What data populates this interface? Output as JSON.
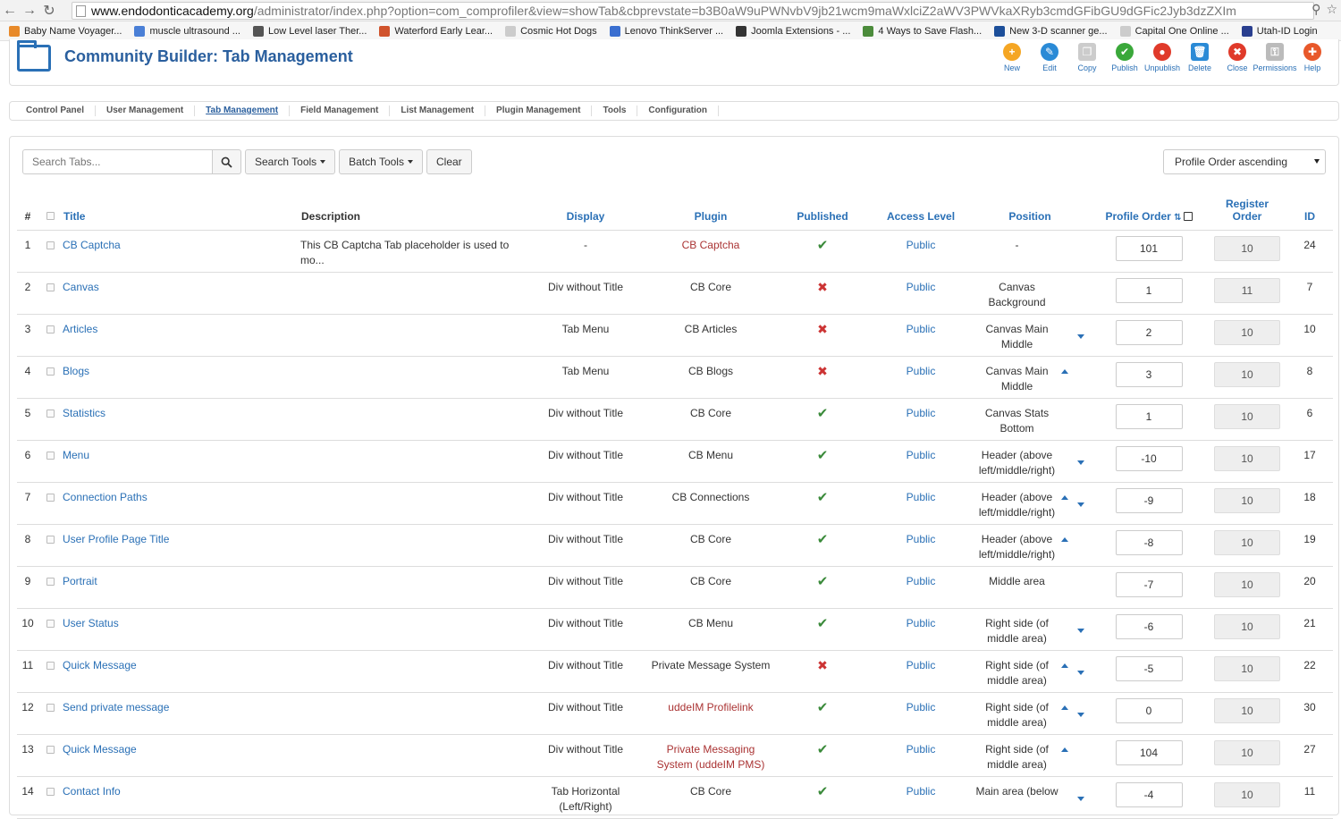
{
  "browser": {
    "url_domain": "www.endodonticacademy.org",
    "url_path": "/administrator/index.php?option=com_comprofiler&view=showTab&cbprevstate=b3B0aW9uPWNvbV9jb21wcm9maWxlciZ2aWV3PWVkaXRyb3cmdGFibGU9dGFic2Jyb3dzZXIm"
  },
  "bookmarks": [
    {
      "label": "Baby Name Voyager...",
      "color": "#e88a2a"
    },
    {
      "label": "muscle ultrasound ...",
      "color": "#4a7fd6"
    },
    {
      "label": "Low Level laser Ther...",
      "color": "#555555"
    },
    {
      "label": "Waterford Early Lear...",
      "color": "#d0532c"
    },
    {
      "label": "Cosmic Hot Dogs",
      "color": "#cccccc"
    },
    {
      "label": "Lenovo ThinkServer ...",
      "color": "#3a6fd0"
    },
    {
      "label": "Joomla Extensions - ...",
      "color": "#333333"
    },
    {
      "label": "4 Ways to Save Flash...",
      "color": "#4b8b3b"
    },
    {
      "label": "New 3-D scanner ge...",
      "color": "#1d4f9a"
    },
    {
      "label": "Capital One Online ...",
      "color": "#cccccc"
    },
    {
      "label": "Utah-ID Login",
      "color": "#2a3f8f"
    }
  ],
  "header": {
    "title": "Community Builder: Tab Management"
  },
  "toolbar": [
    {
      "label": "New",
      "icon": "plus-icon",
      "color": "#f5a623",
      "glyph": "+"
    },
    {
      "label": "Edit",
      "icon": "pencil-icon",
      "color": "#2a8ad6",
      "glyph": "✎"
    },
    {
      "label": "Copy",
      "icon": "copy-icon",
      "color": "#cccccc",
      "glyph": "❐"
    },
    {
      "label": "Publish",
      "icon": "check-icon",
      "color": "#3aa83a",
      "glyph": "✔"
    },
    {
      "label": "Unpublish",
      "icon": "unpublish-icon",
      "color": "#e03a2a",
      "glyph": "●"
    },
    {
      "label": "Delete",
      "icon": "trash-icon",
      "color": "#2a8ad6",
      "glyph": "🗑"
    },
    {
      "label": "Close",
      "icon": "close-icon",
      "color": "#e03a2a",
      "glyph": "✖"
    },
    {
      "label": "Permissions",
      "icon": "permissions-icon",
      "color": "#bbbbbb",
      "glyph": "⚿"
    },
    {
      "label": "Help",
      "icon": "help-icon",
      "color": "#e8582a",
      "glyph": "✚"
    }
  ],
  "submenu": [
    {
      "label": "Control Panel",
      "active": false
    },
    {
      "label": "User Management",
      "active": false
    },
    {
      "label": "Tab Management",
      "active": true
    },
    {
      "label": "Field Management",
      "active": false
    },
    {
      "label": "List Management",
      "active": false
    },
    {
      "label": "Plugin Management",
      "active": false
    },
    {
      "label": "Tools",
      "active": false
    },
    {
      "label": "Configuration",
      "active": false
    }
  ],
  "filters": {
    "search_placeholder": "Search Tabs...",
    "search_tools": "Search Tools",
    "batch_tools": "Batch Tools",
    "clear": "Clear",
    "sort": "Profile Order ascending"
  },
  "columns": {
    "num": "#",
    "title": "Title",
    "description": "Description",
    "display": "Display",
    "plugin": "Plugin",
    "published": "Published",
    "access": "Access Level",
    "position": "Position",
    "profile_order": "Profile Order",
    "register_order": "Register Order",
    "id": "ID"
  },
  "rows": [
    {
      "num": "1",
      "title": "CB Captcha",
      "description": "This CB Captcha Tab placeholder is used to mo...",
      "display": "-",
      "plugin": "CB Captcha",
      "plugin_red": true,
      "published": true,
      "access": "Public",
      "position": "-",
      "up": false,
      "down": false,
      "profile_order": "101",
      "register_order": "10",
      "id": "24"
    },
    {
      "num": "2",
      "title": "Canvas",
      "description": "",
      "display": "Div without Title",
      "plugin": "CB Core",
      "plugin_red": false,
      "published": false,
      "access": "Public",
      "position": "Canvas Background",
      "up": false,
      "down": false,
      "profile_order": "1",
      "register_order": "11",
      "id": "7"
    },
    {
      "num": "3",
      "title": "Articles",
      "description": "",
      "display": "Tab Menu",
      "plugin": "CB Articles",
      "plugin_red": false,
      "published": false,
      "access": "Public",
      "position": "Canvas Main Middle",
      "up": false,
      "down": true,
      "profile_order": "2",
      "register_order": "10",
      "id": "10"
    },
    {
      "num": "4",
      "title": "Blogs",
      "description": "",
      "display": "Tab Menu",
      "plugin": "CB Blogs",
      "plugin_red": false,
      "published": false,
      "access": "Public",
      "position": "Canvas Main Middle",
      "up": true,
      "down": false,
      "profile_order": "3",
      "register_order": "10",
      "id": "8"
    },
    {
      "num": "5",
      "title": "Statistics",
      "description": "",
      "display": "Div without Title",
      "plugin": "CB Core",
      "plugin_red": false,
      "published": true,
      "access": "Public",
      "position": "Canvas Stats Bottom",
      "up": false,
      "down": false,
      "profile_order": "1",
      "register_order": "10",
      "id": "6"
    },
    {
      "num": "6",
      "title": "Menu",
      "description": "",
      "display": "Div without Title",
      "plugin": "CB Menu",
      "plugin_red": false,
      "published": true,
      "access": "Public",
      "position": "Header (above left/middle/right)",
      "up": false,
      "down": true,
      "profile_order": "-10",
      "register_order": "10",
      "id": "17"
    },
    {
      "num": "7",
      "title": "Connection Paths",
      "description": "",
      "display": "Div without Title",
      "plugin": "CB Connections",
      "plugin_red": false,
      "published": true,
      "access": "Public",
      "position": "Header (above left/middle/right)",
      "up": true,
      "down": true,
      "profile_order": "-9",
      "register_order": "10",
      "id": "18"
    },
    {
      "num": "8",
      "title": "User Profile Page Title",
      "description": "",
      "display": "Div without Title",
      "plugin": "CB Core",
      "plugin_red": false,
      "published": true,
      "access": "Public",
      "position": "Header (above left/middle/right)",
      "up": true,
      "down": false,
      "profile_order": "-8",
      "register_order": "10",
      "id": "19"
    },
    {
      "num": "9",
      "title": "Portrait",
      "description": "",
      "display": "Div without Title",
      "plugin": "CB Core",
      "plugin_red": false,
      "published": true,
      "access": "Public",
      "position": "Middle area",
      "up": false,
      "down": false,
      "profile_order": "-7",
      "register_order": "10",
      "id": "20"
    },
    {
      "num": "10",
      "title": "User Status",
      "description": "",
      "display": "Div without Title",
      "plugin": "CB Menu",
      "plugin_red": false,
      "published": true,
      "access": "Public",
      "position": "Right side (of middle area)",
      "up": false,
      "down": true,
      "profile_order": "-6",
      "register_order": "10",
      "id": "21"
    },
    {
      "num": "11",
      "title": "Quick Message",
      "description": "",
      "display": "Div without Title",
      "plugin": "Private Message System",
      "plugin_red": false,
      "published": false,
      "access": "Public",
      "position": "Right side (of middle area)",
      "up": true,
      "down": true,
      "profile_order": "-5",
      "register_order": "10",
      "id": "22"
    },
    {
      "num": "12",
      "title": "Send private message",
      "description": "",
      "display": "Div without Title",
      "plugin": "uddeIM Profilelink",
      "plugin_red": true,
      "published": true,
      "access": "Public",
      "position": "Right side (of middle area)",
      "up": true,
      "down": true,
      "profile_order": "0",
      "register_order": "10",
      "id": "30"
    },
    {
      "num": "13",
      "title": "Quick Message",
      "description": "",
      "display": "Div without Title",
      "plugin": "Private Messaging System (uddeIM PMS)",
      "plugin_red": true,
      "published": true,
      "access": "Public",
      "position": "Right side (of middle area)",
      "up": true,
      "down": false,
      "profile_order": "104",
      "register_order": "10",
      "id": "27"
    },
    {
      "num": "14",
      "title": "Contact Info",
      "description": "",
      "display": "Tab Horizontal (Left/Right)",
      "plugin": "CB Core",
      "plugin_red": false,
      "published": true,
      "access": "Public",
      "position": "Main area (below",
      "up": false,
      "down": true,
      "profile_order": "-4",
      "register_order": "10",
      "id": "11"
    }
  ]
}
